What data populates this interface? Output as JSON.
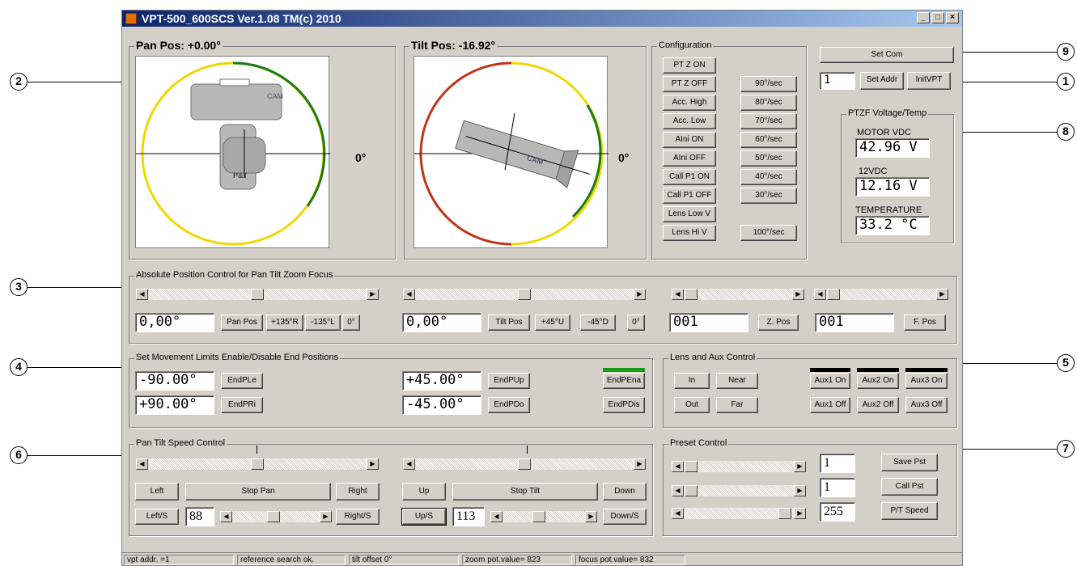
{
  "window": {
    "title": "VPT-500_600SCS Ver.1.08 TM(c) 2010",
    "min": "_",
    "max": "□",
    "close": "×"
  },
  "pan": {
    "title": "Pan Pos: +0.00°",
    "zero": "0°",
    "cam": "CAM",
    "pt": "P&T"
  },
  "tilt": {
    "title": "Tilt Pos: -16.92°",
    "zero": "0°",
    "cam": "CAM"
  },
  "config": {
    "title": "Configuration",
    "left": [
      "PT Z ON",
      "PT Z OFF",
      "Acc. High",
      "Acc. Low",
      "AIni ON",
      "AIni OFF",
      "Call P1 ON",
      "Call P1 OFF",
      "Lens Low V",
      "Lens Hi V"
    ],
    "right": [
      "90°/sec",
      "80°/sec",
      "70°/sec",
      "60°/sec",
      "50°/sec",
      "40°/sec",
      "30°/sec",
      "100°/sec"
    ]
  },
  "com": {
    "set_com": "Set Com",
    "addr_value": "1",
    "set_addr": "Set Addr",
    "init": "InitVPT"
  },
  "voltage": {
    "title": "PTZF Voltage/Temp",
    "motor_label": "MOTOR VDC",
    "motor_value": "42.96 V",
    "v12_label": "12VDC",
    "v12_value": "12.16 V",
    "temp_label": "TEMPERATURE",
    "temp_value": "33.2 °C"
  },
  "abs": {
    "title": "Absolute Position Control for Pan Tilt Zoom Focus",
    "pan_value": "0,00°",
    "pan_pos": "Pan Pos",
    "pan_r": "+135°R",
    "pan_l": "-135°L",
    "pan_zero": "0°",
    "tilt_value": "0,00°",
    "tilt_pos": "Tilt Pos",
    "tilt_u": "+45°U",
    "tilt_d": "-45°D",
    "tilt_zero": "0°",
    "zoom_value": "001",
    "zoom_pos": "Z. Pos",
    "focus_value": "001",
    "focus_pos": "F. Pos"
  },
  "limits": {
    "title": "Set Movement Limits  Enable/Disable End Positions",
    "ple_value": "-90.00°",
    "ple": "EndPLe",
    "pri_value": "+90.00°",
    "pri": "EndPRi",
    "pup_value": "+45.00°",
    "pup": "EndPUp",
    "pdo_value": "-45.00°",
    "pdo": "EndPDo",
    "ena": "EndPEna",
    "dis": "EndPDis"
  },
  "lens": {
    "title": "Lens  and Aux Control",
    "in": "In",
    "near": "Near",
    "out": "Out",
    "far": "Far",
    "aux1_on": "Aux1 On",
    "aux2_on": "Aux2 On",
    "aux3_on": "Aux3 On",
    "aux1_off": "Aux1 Off",
    "aux2_off": "Aux2 Off",
    "aux3_off": "Aux3 Off"
  },
  "speed": {
    "title": "Pan Tilt Speed Control",
    "left": "Left",
    "stop_pan": "Stop Pan",
    "right": "Right",
    "up": "Up",
    "stop_tilt": "Stop Tilt",
    "down": "Down",
    "left_s": "Left/S",
    "pan_speed": "88",
    "right_s": "Right/S",
    "up_s": "Up/S",
    "tilt_speed": "113",
    "down_s": "Down/S"
  },
  "preset": {
    "title": "Preset Control",
    "v1": "1",
    "v2": "1",
    "v3": "255",
    "save": "Save Pst",
    "call": "Call Pst",
    "speed": "P/T Speed"
  },
  "status": [
    "vpt addr. =1",
    "reference search ok.",
    "tilt offset 0°",
    "zoom pot.value= 823",
    "focus pot.value= 832"
  ],
  "callouts": [
    "1",
    "2",
    "3",
    "4",
    "5",
    "6",
    "7",
    "8",
    "9"
  ],
  "colors": {
    "yellow": "#f0d800",
    "green": "#1a7a1a",
    "red": "#c0341a",
    "title_bar": "#0a246a"
  }
}
